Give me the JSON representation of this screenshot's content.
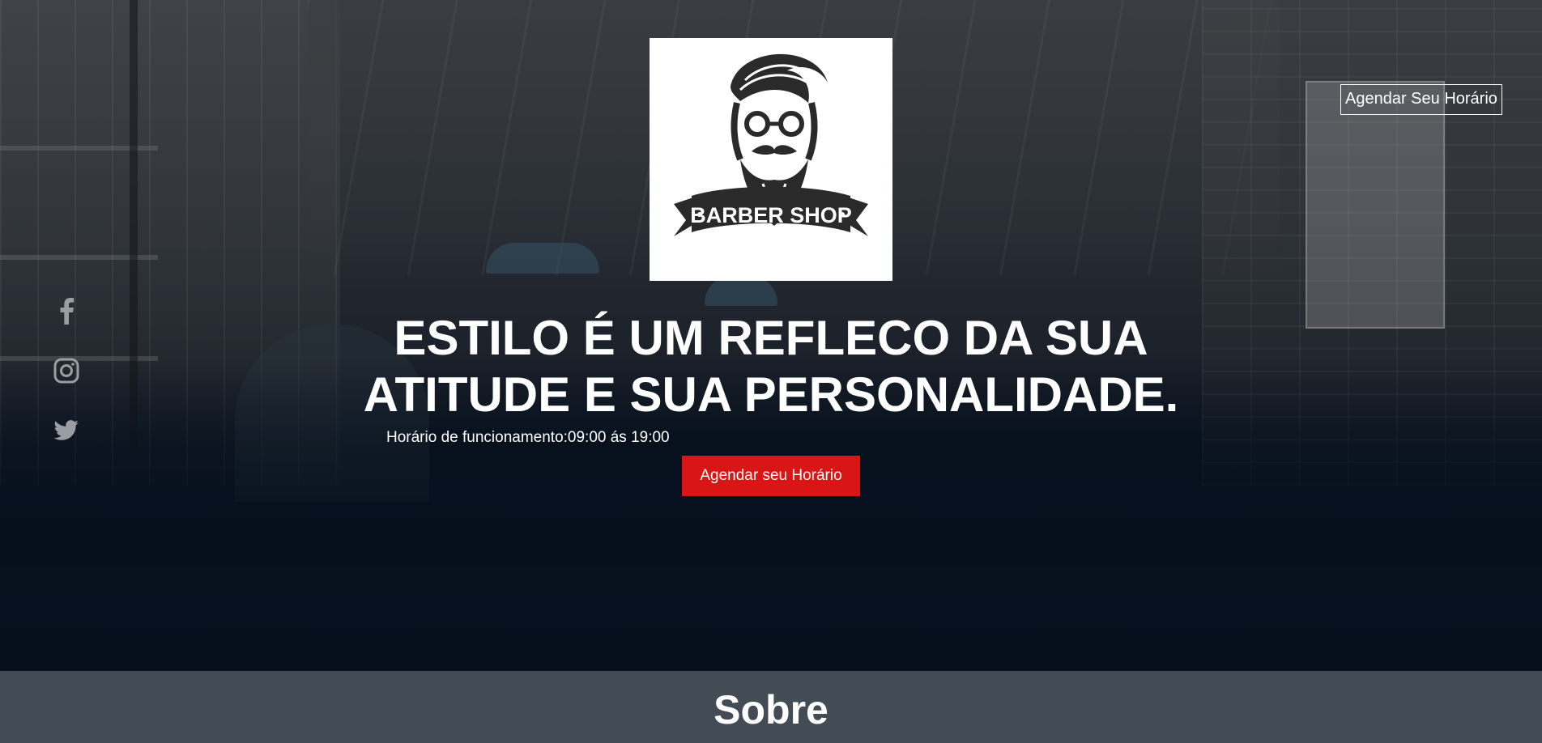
{
  "brand": {
    "logo_text": "BARBER SHOP"
  },
  "header": {
    "cta_label": "Agendar Seu Horário"
  },
  "social": [
    {
      "name": "facebook-icon"
    },
    {
      "name": "instagram-icon"
    },
    {
      "name": "twitter-icon"
    }
  ],
  "hero": {
    "headline_line1": "ESTILO É UM REFLECO DA SUA",
    "headline_line2": "ATITUDE E SUA PERSONALIDADE.",
    "hours": "Horário de funcionamento:09:00 ás 19:00",
    "cta_label": "Agendar seu Horário"
  },
  "about": {
    "title": "Sobre"
  },
  "colors": {
    "accent": "#d91515",
    "hero_bg": "#06101d",
    "section_bg": "#434b54",
    "text": "#ffffff"
  }
}
